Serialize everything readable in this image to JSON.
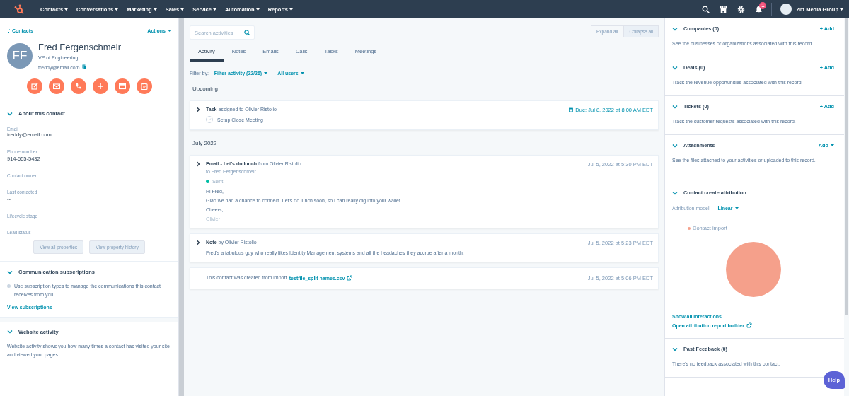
{
  "nav": {
    "items": [
      "Contacts",
      "Conversations",
      "Marketing",
      "Sales",
      "Service",
      "Automation",
      "Reports"
    ],
    "notification_count": "1",
    "account": "Ziff Media Group"
  },
  "contact": {
    "back": "Contacts",
    "actions": "Actions",
    "initials": "FF",
    "name": "Fred Fergenschmeir",
    "job_title": "VP of Engineering",
    "email": "freddy@email.com"
  },
  "about": {
    "title": "About this contact",
    "expanded": true,
    "properties": [
      {
        "label": "Email",
        "value": "freddy@email.com"
      },
      {
        "label": "Phone number",
        "value": "914-555-5432"
      },
      {
        "label": "Contact owner"
      },
      {
        "label": "Last contacted",
        "value": "--"
      },
      {
        "label": "Lifecycle stage"
      },
      {
        "label": "Lead status"
      }
    ],
    "buttons": [
      "View all properties",
      "View property history"
    ]
  },
  "subscriptions": {
    "title": "Communication subscriptions",
    "expanded": true,
    "text": "Use subscription types to manage the communications this contact receives from you",
    "link": "View subscriptions"
  },
  "website_activity": {
    "title": "Website activity",
    "expanded": true,
    "text": "Website activity shows you how many times a contact has visited your site and viewed your pages."
  },
  "activity": {
    "search": {
      "placeholder": "Search activities"
    },
    "expand_all": "Expand all",
    "collapse_all": "Collapse all",
    "tabs": [
      {
        "label": "Activity",
        "selected": true
      },
      {
        "label": "Notes",
        "selected": false
      },
      {
        "label": "Emails",
        "selected": false
      },
      {
        "label": "Calls",
        "selected": false
      },
      {
        "label": "Tasks",
        "selected": false
      },
      {
        "label": "Meetings",
        "selected": false
      }
    ],
    "filter_label": "Filter by:",
    "filter": "Filter activity (22/26)",
    "users": "All users",
    "groups": [
      {
        "heading": "Upcoming",
        "items": [
          {
            "kind": "task",
            "expanded": false,
            "title": "**Task** assigned to Olivier Ristolio",
            "time": "Due: Jul 8, 2022 at 8:00 AM EDT",
            "task": "Setup Close Meeting",
            "done": false
          }
        ]
      },
      {
        "heading": "July 2022",
        "items": [
          {
            "kind": "email",
            "expanded": false,
            "title": "**Email - Let's do lunch** from Olivier Ristolio",
            "to": "to Fred Fergenschmeir",
            "status": "Sent",
            "time": "Jul 5, 2022 at 5:30 PM EDT",
            "body": [
              "Hi Fred,",
              "Glad we had a chance to connect. Let's do lunch soon, so I can really dig into your wallet.",
              "Cheers,"
            ],
            "faded": "Olivier"
          },
          {
            "kind": "note",
            "expanded": false,
            "title": "**Note** by Olivier Ristolio",
            "time": "Jul 5, 2022 at 5:23 PM EDT",
            "body": [
              "Fred's a fabulous guy who really likes Identity Management systems and all the headaches they accrue after a month."
            ]
          },
          {
            "kind": "import",
            "text": "This contact was created from import",
            "link": "testfile_split names.csv",
            "time": "Jul 5, 2022 at 5:06 PM EDT"
          }
        ]
      }
    ]
  },
  "sidebar": {
    "cards": [
      {
        "kind": "assoc",
        "title": "Companies (0)",
        "expanded": true,
        "action": "+ Add",
        "text": "See the businesses or organizations associated with this record."
      },
      {
        "kind": "assoc",
        "title": "Deals (0)",
        "expanded": true,
        "action": "+ Add",
        "text": "Track the revenue opportunities associated with this record."
      },
      {
        "kind": "assoc",
        "title": "Tickets (0)",
        "expanded": true,
        "action": "+ Add",
        "text": "Track the customer requests associated with this record."
      },
      {
        "kind": "menu",
        "title": "Attachments",
        "expanded": true,
        "action": "Add",
        "text": "See the files attached to your activities or uploaded to this record."
      },
      {
        "kind": "attribution",
        "title": "Contact create attribution",
        "expanded": true,
        "model_label": "Attribution model:",
        "model": "Linear",
        "legend": "Contact import",
        "links": [
          "Show all interactions",
          "Open attribution report builder"
        ]
      },
      {
        "kind": "assoc",
        "title": "Past Feedback (0)",
        "expanded": true,
        "text": "There's no feedback associated with this contact."
      }
    ]
  },
  "help": "Help"
}
